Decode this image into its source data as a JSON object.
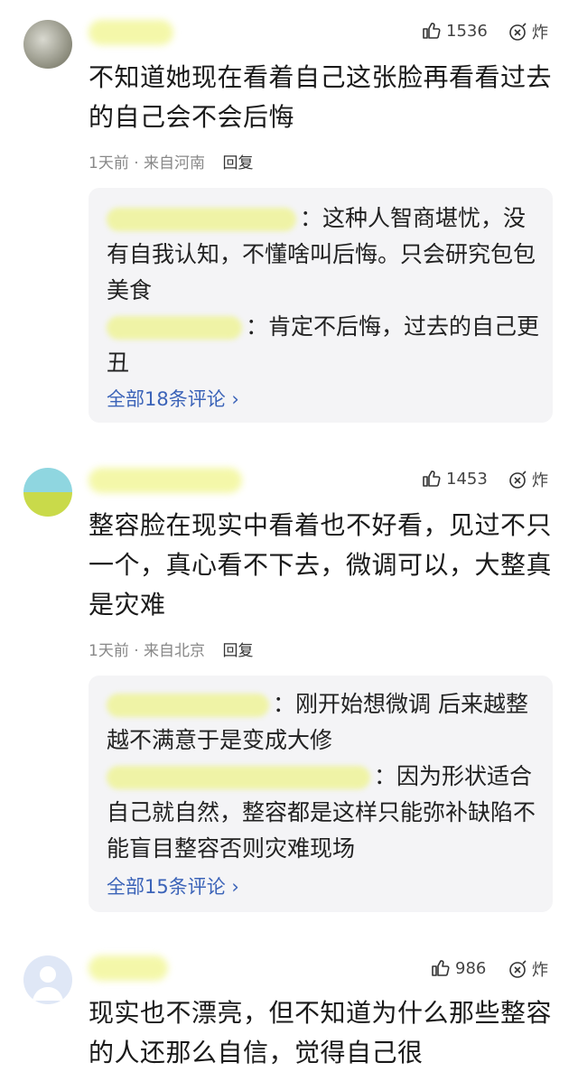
{
  "comments": [
    {
      "likes": "1536",
      "bomb_label": "炸",
      "text": "不知道她现在看着自己这张脸再看看过去的自己会不会后悔",
      "time": "1天前",
      "location": "来自河南",
      "reply_label": "回复",
      "replies": [
        {
          "text": "：这种人智商堪忧，没有自我认知，不懂啥叫后悔。只会研究包包美食"
        },
        {
          "text": "：肯定不后悔，过去的自己更丑"
        }
      ],
      "view_all": "全部18条评论 ›"
    },
    {
      "likes": "1453",
      "bomb_label": "炸",
      "text": "整容脸在现实中看着也不好看，见过不只一个，真心看不下去，微调可以，大整真是灾难",
      "time": "1天前",
      "location": "来自北京",
      "reply_label": "回复",
      "replies": [
        {
          "text": "：刚开始想微调 后来越整越不满意于是变成大修"
        },
        {
          "text": "：因为形状适合自己就自然，整容都是这样只能弥补缺陷不能盲目整容否则灾难现场"
        }
      ],
      "view_all": "全部15条评论 ›"
    },
    {
      "likes": "986",
      "bomb_label": "炸",
      "text": "现实也不漂亮，但不知道为什么那些整容的人还那么自信，觉得自己很"
    }
  ]
}
